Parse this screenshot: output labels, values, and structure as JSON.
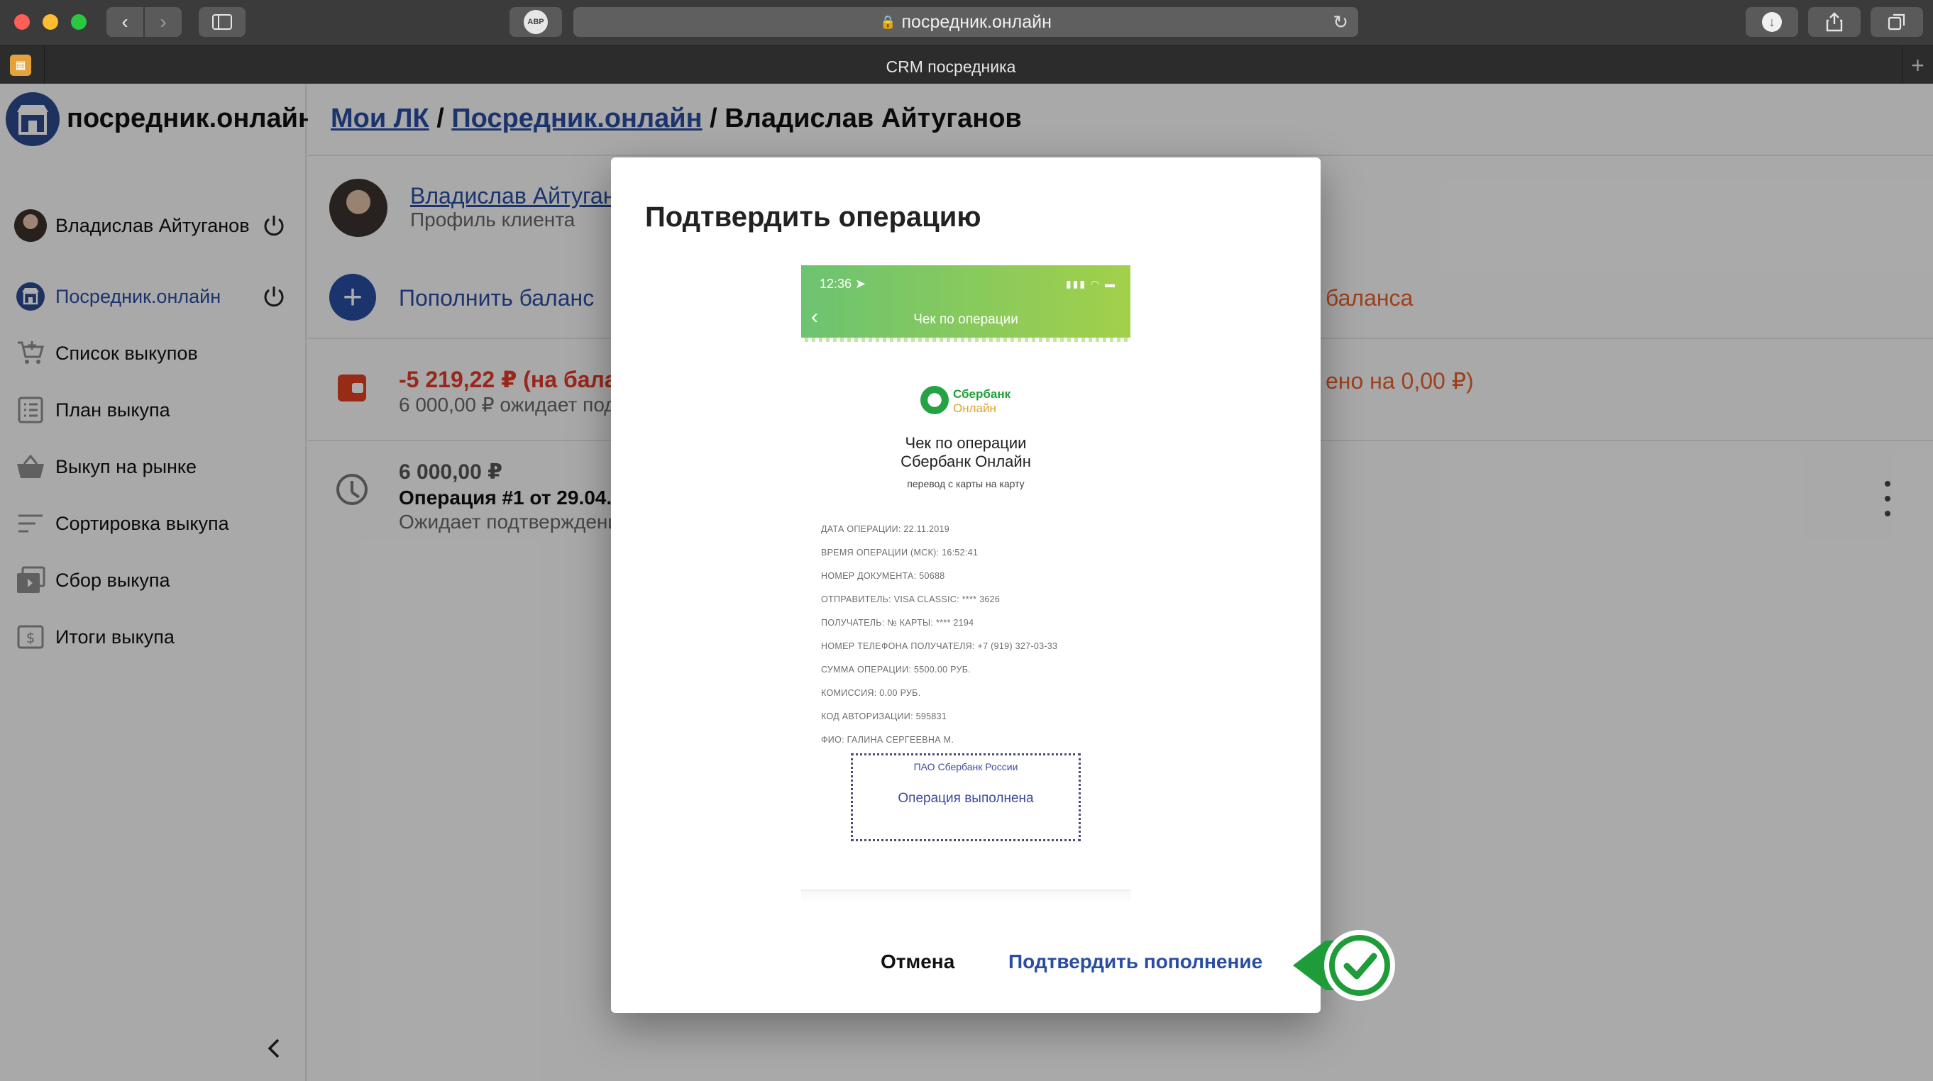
{
  "browser": {
    "url": "посредник.онлайн",
    "tab_title": "CRM посредника",
    "abp_label": "ABP"
  },
  "app": {
    "logo_text": "посредник.онлайн",
    "breadcrumb": {
      "link1": "Мои ЛК",
      "sep1": " / ",
      "link2": "Посредник.онлайн",
      "sep2": " / ",
      "current": "Владислав Айтуганов"
    }
  },
  "sidebar": {
    "user_name": "Владислав Айтуганов",
    "items": [
      {
        "label": "Посредник.онлайн",
        "icon": "store-icon"
      },
      {
        "label": "Список выкупов",
        "icon": "cart-icon"
      },
      {
        "label": "План выкупа",
        "icon": "list-icon"
      },
      {
        "label": "Выкуп на рынке",
        "icon": "basket-icon"
      },
      {
        "label": "Сортировка выкупа",
        "icon": "sort-icon"
      },
      {
        "label": "Сбор выкупа",
        "icon": "package-icon"
      },
      {
        "label": "Итоги выкупа",
        "icon": "dollar-icon"
      }
    ]
  },
  "client": {
    "name": "Владислав Айтуган",
    "subtitle": "Профиль клиента"
  },
  "actions": {
    "add_balance": "Пополнить баланс",
    "right_label": "баланса"
  },
  "balance": {
    "amount_line": "-5 219,22 ₽ (на бала",
    "pending_line": "6 000,00 ₽ ожидает под",
    "right_line": "ено на 0,00 ₽)"
  },
  "operation": {
    "amount": "6 000,00 ₽",
    "title": "Операция #1 от 29.04.20",
    "status": "Ожидает подтверждени"
  },
  "modal": {
    "title": "Подтвердить операцию",
    "cancel": "Отмена",
    "confirm": "Подтвердить пополнение"
  },
  "receipt": {
    "time": "12:36",
    "header_title": "Чек по операции",
    "bank_name_line1": "Сбербанк",
    "bank_name_line2": "Онлайн",
    "title_line1": "Чек по операции",
    "title_line2": "Сбербанк Онлайн",
    "subtitle": "перевод с карты на карту",
    "rows": [
      "ДАТА ОПЕРАЦИИ: 22.11.2019",
      "ВРЕМЯ ОПЕРАЦИИ (МСК): 16:52:41",
      "НОМЕР ДОКУМЕНТА: 50688",
      "ОТПРАВИТЕЛЬ: VISA CLASSIC: **** 3626",
      "ПОЛУЧАТЕЛЬ: № КАРТЫ: **** 2194",
      "НОМЕР ТЕЛЕФОНА ПОЛУЧАТЕЛЯ: +7 (919) 327-03-33",
      "СУММА ОПЕРАЦИИ: 5500.00 РУБ.",
      "КОМИССИЯ: 0.00 РУБ.",
      "КОД АВТОРИЗАЦИИ: 595831",
      "ФИО: ГАЛИНА СЕРГЕЕВНА М."
    ],
    "stamp_bank": "ПАО Сбербанк России",
    "stamp_status": "Операция выполнена"
  },
  "colors": {
    "accent_blue": "#2a4da3",
    "negative_red": "#e03a2a",
    "confirm_green": "#2fb24a"
  }
}
